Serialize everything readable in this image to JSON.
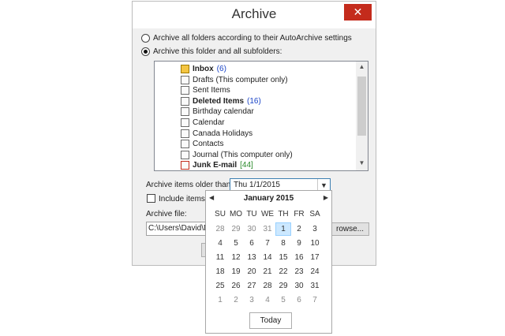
{
  "dialog": {
    "title": "Archive",
    "close_glyph": "✕",
    "close_icon": "close-icon",
    "options": [
      {
        "label": "Archive all folders according to their AutoArchive settings",
        "selected": false
      },
      {
        "label": "Archive this folder and all subfolders:",
        "selected": true
      }
    ],
    "folders": [
      {
        "name": "Inbox",
        "count": "(6)",
        "bold": true,
        "count_color": "blue",
        "icon": "inbox-icon"
      },
      {
        "name": "Drafts (This computer only)",
        "count": "",
        "bold": false,
        "icon": "drafts-icon"
      },
      {
        "name": "Sent Items",
        "count": "",
        "bold": false,
        "icon": "sent-icon"
      },
      {
        "name": "Deleted Items",
        "count": "(16)",
        "bold": true,
        "count_color": "blue",
        "icon": "deleted-items-icon"
      },
      {
        "name": "Birthday calendar",
        "count": "",
        "bold": false,
        "icon": "calendar-icon"
      },
      {
        "name": "Calendar",
        "count": "",
        "bold": false,
        "icon": "calendar-icon"
      },
      {
        "name": "Canada Holidays",
        "count": "",
        "bold": false,
        "icon": "calendar-icon"
      },
      {
        "name": "Contacts",
        "count": "",
        "bold": false,
        "icon": "contacts-icon"
      },
      {
        "name": "Journal (This computer only)",
        "count": "",
        "bold": false,
        "icon": "journal-icon"
      },
      {
        "name": "Junk E-mail",
        "count": "[44]",
        "bold": true,
        "count_color": "green",
        "icon": "junk-icon"
      }
    ],
    "older_than_label": "Archive items older than:",
    "older_than_value": "Thu 1/1/2015",
    "include_label": "Include items w",
    "archive_file_label": "Archive file:",
    "archive_file_value": "C:\\Users\\David\\Do",
    "browse_label": "rowse...",
    "colors": {
      "close": "#c42b1c",
      "selection": "#cce8ff",
      "count_blue": "#1a44c7",
      "count_green": "#2a8a2a"
    }
  },
  "calendar": {
    "month_title": "January 2015",
    "prev_glyph": "◀",
    "next_glyph": "▶",
    "weekdays": [
      "SU",
      "MO",
      "TU",
      "WE",
      "TH",
      "FR",
      "SA"
    ],
    "weeks": [
      [
        "28",
        "29",
        "30",
        "31",
        "1",
        "2",
        "3"
      ],
      [
        "4",
        "5",
        "6",
        "7",
        "8",
        "9",
        "10"
      ],
      [
        "11",
        "12",
        "13",
        "14",
        "15",
        "16",
        "17"
      ],
      [
        "18",
        "19",
        "20",
        "21",
        "22",
        "23",
        "24"
      ],
      [
        "25",
        "26",
        "27",
        "28",
        "29",
        "30",
        "31"
      ],
      [
        "1",
        "2",
        "3",
        "4",
        "5",
        "6",
        "7"
      ]
    ],
    "selected": "1",
    "today_label": "Today"
  }
}
